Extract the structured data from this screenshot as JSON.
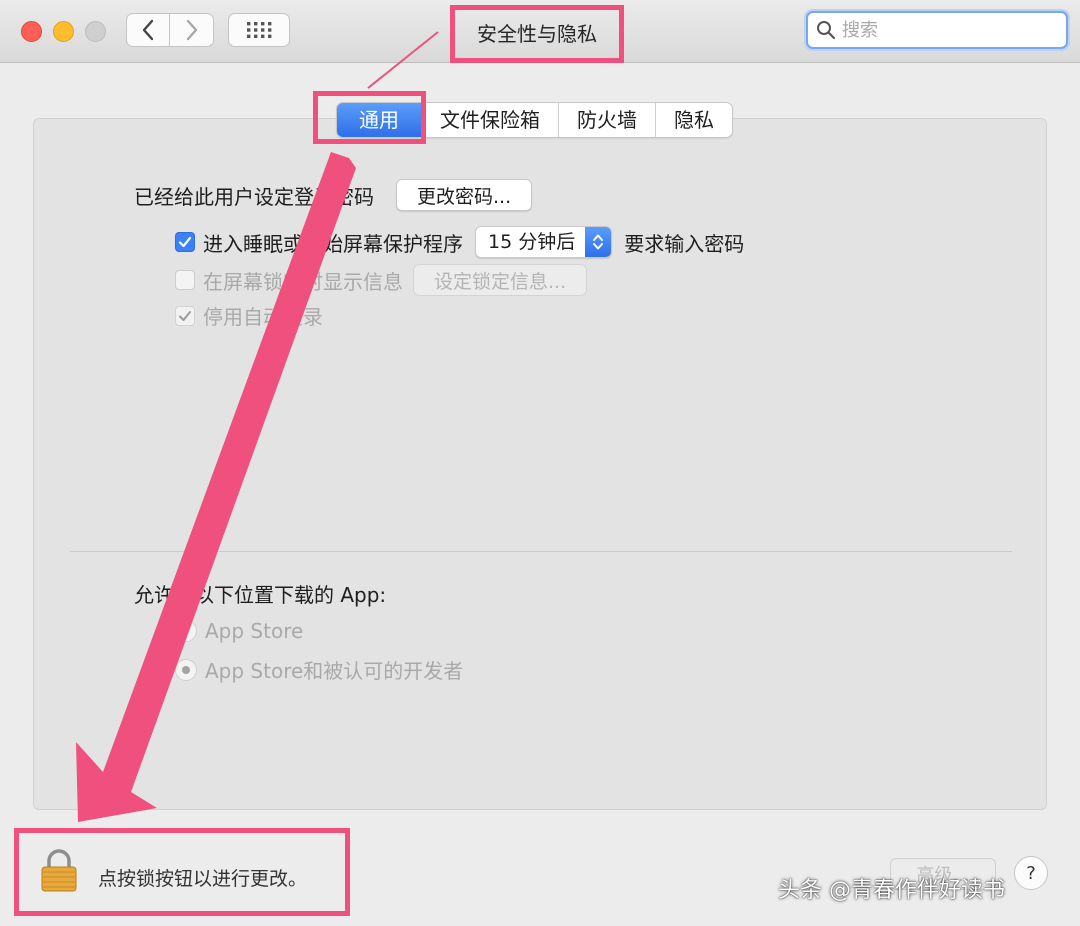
{
  "window": {
    "title": "安全性与隐私"
  },
  "search": {
    "placeholder": "搜索"
  },
  "tabs": [
    {
      "label": "通用",
      "active": true
    },
    {
      "label": "文件保险箱",
      "active": false
    },
    {
      "label": "防火墙",
      "active": false
    },
    {
      "label": "隐私",
      "active": false
    }
  ],
  "general": {
    "password_label": "已经给此用户设定登录密码",
    "change_password_button": "更改密码...",
    "require_password": {
      "checked": true,
      "label_before": "进入睡眠或开始屏幕保护程序",
      "delay_value": "15 分钟后",
      "label_after": "要求输入密码"
    },
    "show_message": {
      "checked": false,
      "label": "在屏幕锁定时显示信息",
      "button": "设定锁定信息..."
    },
    "disable_autologin": {
      "checked": true,
      "label": "停用自动登录"
    },
    "allow_apps_label": "允许从以下位置下载的 App:",
    "allow_options": [
      {
        "label": "App Store",
        "selected": false
      },
      {
        "label": "App Store和被认可的开发者",
        "selected": true
      }
    ]
  },
  "footer": {
    "lock_text": "点按锁按钮以进行更改。",
    "advanced_button": "高级...",
    "help_button": "?"
  },
  "watermark": "头条 @青春作伴好读书",
  "colors": {
    "annotation": "#f0507e",
    "accent": "#3a82f6",
    "lock": "#e6a93a"
  }
}
